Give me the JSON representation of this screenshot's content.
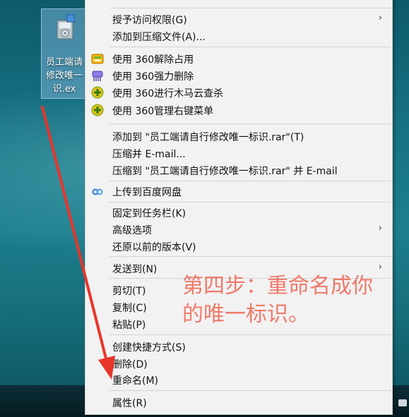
{
  "desktop": {
    "file": {
      "label_line1": "员工端请",
      "label_line2": "修改唯一",
      "label_line3": "识.ex"
    }
  },
  "context_menu": {
    "top_partial": "…",
    "items": [
      {
        "label": "授予访问权限(G)",
        "submenu": true,
        "icon": ""
      },
      {
        "label": "添加到压缩文件(A)...",
        "submenu": false,
        "icon": ""
      },
      {
        "label": "使用 360解除占用",
        "submenu": false,
        "icon": "unlock-360-icon"
      },
      {
        "label": "使用 360强力删除",
        "submenu": false,
        "icon": "shred-360-icon"
      },
      {
        "label": "使用 360进行木马云查杀",
        "submenu": false,
        "icon": "plus-360-icon"
      },
      {
        "label": "使用 360管理右键菜单",
        "submenu": false,
        "icon": "plus-360-icon"
      },
      {
        "label": "添加到 \"员工端请自行修改唯一标识.rar\"(T)",
        "submenu": false,
        "icon": ""
      },
      {
        "label": "压缩并 E-mail...",
        "submenu": false,
        "icon": ""
      },
      {
        "label": "压缩到 \"员工端请自行修改唯一标识.rar\" 并 E-mail",
        "submenu": false,
        "icon": ""
      },
      {
        "label": "上传到百度网盘",
        "submenu": false,
        "icon": "baidu-cloud-icon"
      },
      {
        "label": "固定到任务栏(K)",
        "submenu": false,
        "icon": ""
      },
      {
        "label": "高级选项",
        "submenu": true,
        "icon": ""
      },
      {
        "label": "还原以前的版本(V)",
        "submenu": false,
        "icon": ""
      },
      {
        "label": "发送到(N)",
        "submenu": true,
        "icon": ""
      },
      {
        "label": "剪切(T)",
        "submenu": false,
        "icon": ""
      },
      {
        "label": "复制(C)",
        "submenu": false,
        "icon": ""
      },
      {
        "label": "粘贴(P)",
        "submenu": false,
        "icon": ""
      },
      {
        "label": "创建快捷方式(S)",
        "submenu": false,
        "icon": ""
      },
      {
        "label": "删除(D)",
        "submenu": false,
        "icon": ""
      },
      {
        "label": "重命名(M)",
        "submenu": false,
        "icon": ""
      },
      {
        "label": "属性(R)",
        "submenu": false,
        "icon": ""
      }
    ]
  },
  "annotation": {
    "text": "第四步：重命名成你\n的唯一标识。",
    "color": "#f07a6a"
  },
  "colors": {
    "arrow": "#e8352a",
    "menu_bg": "#f2f2f2"
  }
}
